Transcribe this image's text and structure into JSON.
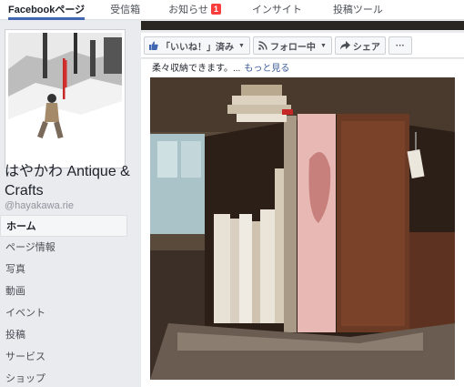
{
  "tabs": [
    {
      "label": "Facebookページ",
      "active": true
    },
    {
      "label": "受信箱",
      "active": false
    },
    {
      "label": "お知らせ",
      "active": false,
      "badge": "1"
    },
    {
      "label": "インサイト",
      "active": false
    },
    {
      "label": "投稿ツール",
      "active": false
    }
  ],
  "page": {
    "name": "はやかわ Antique & Crafts",
    "username": "@hayakawa.rie"
  },
  "nav": [
    {
      "label": "ホーム",
      "active": true
    },
    {
      "label": "ページ情報"
    },
    {
      "label": "写真"
    },
    {
      "label": "動画"
    },
    {
      "label": "イベント"
    },
    {
      "label": "投稿"
    },
    {
      "label": "サービス"
    },
    {
      "label": "ショップ"
    }
  ],
  "actions": {
    "like": "「いいね！」済み",
    "follow": "フォロー中",
    "share": "シェア",
    "more": "···"
  },
  "post": {
    "snippet": "柔々収納できます。...",
    "see_more": "もっと見る"
  },
  "colors": {
    "brand": "#4267b2",
    "badge": "#fa3e3e",
    "link": "#385898"
  }
}
